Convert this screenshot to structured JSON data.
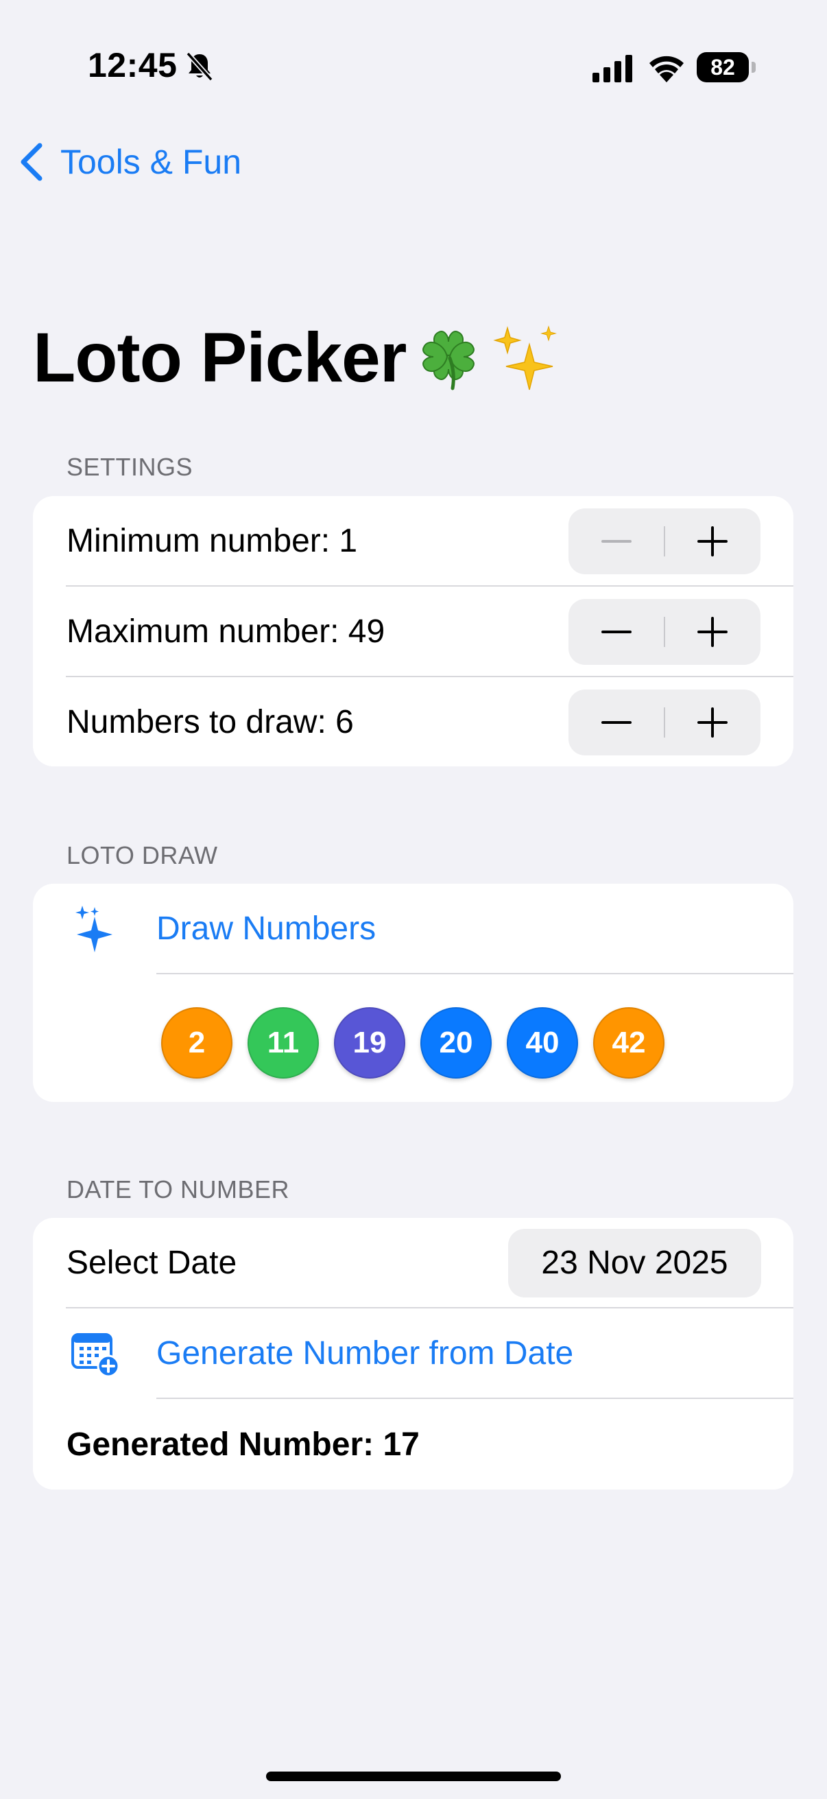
{
  "status_bar": {
    "time": "12:45",
    "battery": "82"
  },
  "nav": {
    "back_label": "Tools & Fun"
  },
  "page": {
    "title": "Loto Picker"
  },
  "settings": {
    "header": "SETTINGS",
    "rows": [
      {
        "label": "Minimum number: 1"
      },
      {
        "label": "Maximum number: 49"
      },
      {
        "label": "Numbers to draw: 6"
      }
    ]
  },
  "loto_draw": {
    "header": "LOTO DRAW",
    "action_label": "Draw Numbers",
    "balls": [
      {
        "value": "2",
        "color": "#ff9500"
      },
      {
        "value": "11",
        "color": "#34c759"
      },
      {
        "value": "19",
        "color": "#5856d6"
      },
      {
        "value": "20",
        "color": "#0a7aff"
      },
      {
        "value": "40",
        "color": "#0a7aff"
      },
      {
        "value": "42",
        "color": "#ff9500"
      }
    ]
  },
  "date_to_number": {
    "header": "DATE TO NUMBER",
    "select_label": "Select Date",
    "date_value": "23 Nov 2025",
    "action_label": "Generate Number from Date",
    "result": "Generated Number: 17"
  },
  "colors": {
    "accent": "#1a7cf4",
    "background": "#f2f2f7"
  }
}
